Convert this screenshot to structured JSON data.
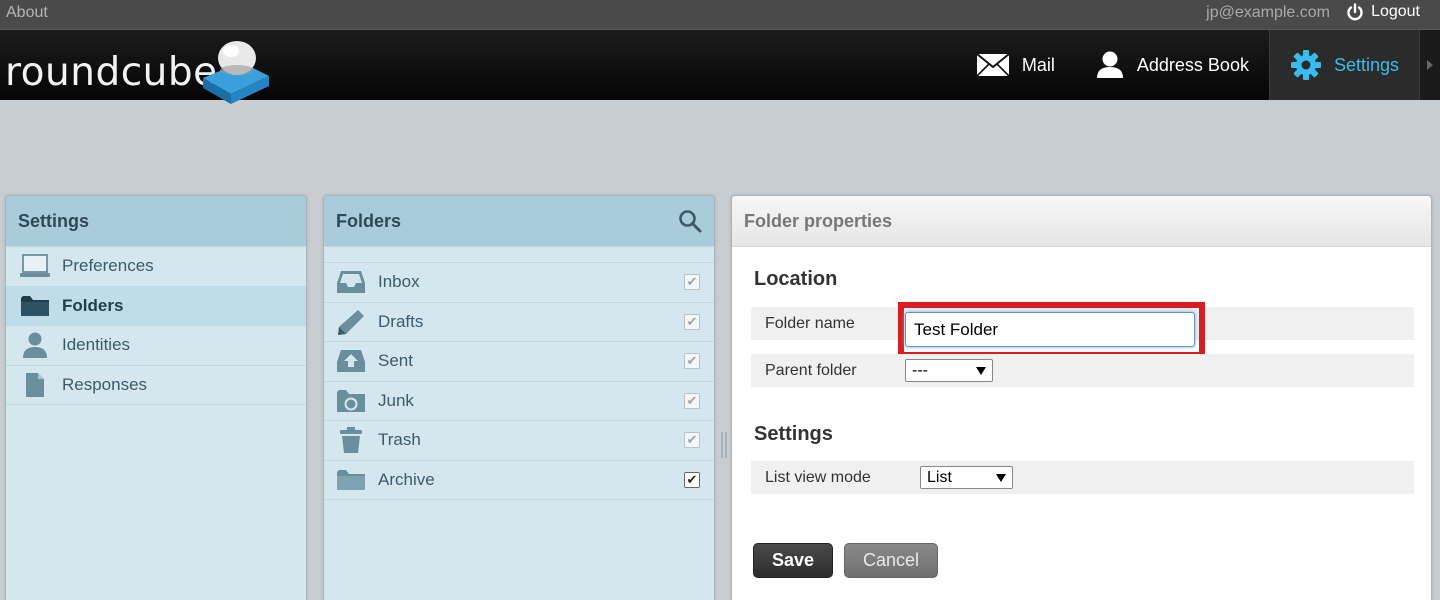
{
  "topbar": {
    "about": "About",
    "user_email": "jp@example.com",
    "logout": "Logout"
  },
  "header": {
    "logo_text": "roundcube",
    "nav": [
      {
        "label": "Mail",
        "icon": "mail-icon"
      },
      {
        "label": "Address Book",
        "icon": "address-book-icon"
      },
      {
        "label": "Settings",
        "icon": "gear-icon",
        "active": true
      }
    ]
  },
  "settings_panel": {
    "title": "Settings",
    "items": [
      {
        "label": "Preferences",
        "icon": "monitor-icon"
      },
      {
        "label": "Folders",
        "icon": "folder-icon",
        "selected": true
      },
      {
        "label": "Identities",
        "icon": "person-icon"
      },
      {
        "label": "Responses",
        "icon": "document-icon"
      }
    ]
  },
  "folders_panel": {
    "title": "Folders",
    "items": [
      {
        "label": "Inbox",
        "icon": "inbox-icon",
        "subscribed": true,
        "locked": true
      },
      {
        "label": "Drafts",
        "icon": "pencil-icon",
        "subscribed": true,
        "locked": true
      },
      {
        "label": "Sent",
        "icon": "sent-icon",
        "subscribed": true,
        "locked": true
      },
      {
        "label": "Junk",
        "icon": "junk-icon",
        "subscribed": true,
        "locked": true
      },
      {
        "label": "Trash",
        "icon": "trash-icon",
        "subscribed": true,
        "locked": true
      },
      {
        "label": "Archive",
        "icon": "folder-icon",
        "subscribed": true,
        "locked": false
      }
    ]
  },
  "properties": {
    "title": "Folder properties",
    "location_heading": "Location",
    "folder_name_label": "Folder name",
    "folder_name_value": "Test Folder",
    "parent_folder_label": "Parent folder",
    "parent_folder_value": "---",
    "settings_heading": "Settings",
    "list_view_mode_label": "List view mode",
    "list_view_mode_value": "List",
    "save_label": "Save",
    "cancel_label": "Cancel"
  },
  "colors": {
    "accent": "#37bdf0",
    "highlight_box": "#d81e1e",
    "panel_head": "#a8ccd9"
  }
}
